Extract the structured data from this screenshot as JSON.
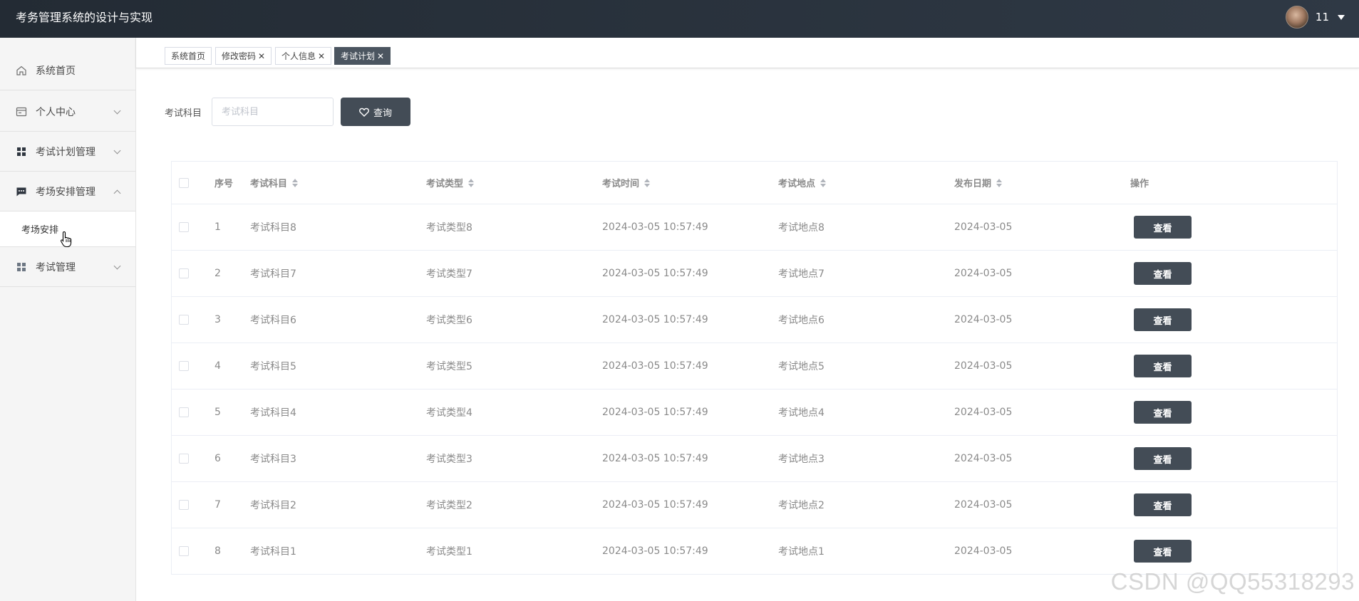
{
  "app": {
    "title": "考务管理系统的设计与实现"
  },
  "user": {
    "name": "11"
  },
  "sidebar": {
    "items": [
      {
        "label": "系统首页",
        "icon": "home-icon"
      },
      {
        "label": "个人中心",
        "icon": "card-icon"
      },
      {
        "label": "考试计划管理",
        "icon": "grid-icon"
      },
      {
        "label": "考场安排管理",
        "icon": "chat-icon"
      },
      {
        "label": "考试管理",
        "icon": "grid-icon"
      }
    ],
    "sub_item": {
      "label": "考场安排"
    }
  },
  "tabs": [
    {
      "label": "系统首页",
      "closable": false,
      "active": false
    },
    {
      "label": "修改密码",
      "closable": true,
      "active": false
    },
    {
      "label": "个人信息",
      "closable": true,
      "active": false
    },
    {
      "label": "考试计划",
      "closable": true,
      "active": true
    }
  ],
  "search": {
    "label": "考试科目",
    "placeholder": "考试科目",
    "button_label": "查询",
    "button_icon": "heart-icon"
  },
  "table": {
    "headers": {
      "index": "序号",
      "subject": "考试科目",
      "type": "考试类型",
      "time": "考试时间",
      "location": "考试地点",
      "date": "发布日期",
      "action": "操作"
    },
    "rows": [
      {
        "index": "1",
        "subject": "考试科目8",
        "type": "考试类型8",
        "time": "2024-03-05 10:57:49",
        "location": "考试地点8",
        "date": "2024-03-05",
        "action": "查看"
      },
      {
        "index": "2",
        "subject": "考试科目7",
        "type": "考试类型7",
        "time": "2024-03-05 10:57:49",
        "location": "考试地点7",
        "date": "2024-03-05",
        "action": "查看"
      },
      {
        "index": "3",
        "subject": "考试科目6",
        "type": "考试类型6",
        "time": "2024-03-05 10:57:49",
        "location": "考试地点6",
        "date": "2024-03-05",
        "action": "查看"
      },
      {
        "index": "4",
        "subject": "考试科目5",
        "type": "考试类型5",
        "time": "2024-03-05 10:57:49",
        "location": "考试地点5",
        "date": "2024-03-05",
        "action": "查看"
      },
      {
        "index": "5",
        "subject": "考试科目4",
        "type": "考试类型4",
        "time": "2024-03-05 10:57:49",
        "location": "考试地点4",
        "date": "2024-03-05",
        "action": "查看"
      },
      {
        "index": "6",
        "subject": "考试科目3",
        "type": "考试类型3",
        "time": "2024-03-05 10:57:49",
        "location": "考试地点3",
        "date": "2024-03-05",
        "action": "查看"
      },
      {
        "index": "7",
        "subject": "考试科目2",
        "type": "考试类型2",
        "time": "2024-03-05 10:57:49",
        "location": "考试地点2",
        "date": "2024-03-05",
        "action": "查看"
      },
      {
        "index": "8",
        "subject": "考试科目1",
        "type": "考试类型1",
        "time": "2024-03-05 10:57:49",
        "location": "考试地点1",
        "date": "2024-03-05",
        "action": "查看"
      }
    ]
  },
  "watermark": "CSDN @QQ55318293",
  "colors": {
    "header_bg": "#2a323c",
    "button_bg": "#434c56",
    "sidebar_bg": "#f5f5f5"
  }
}
